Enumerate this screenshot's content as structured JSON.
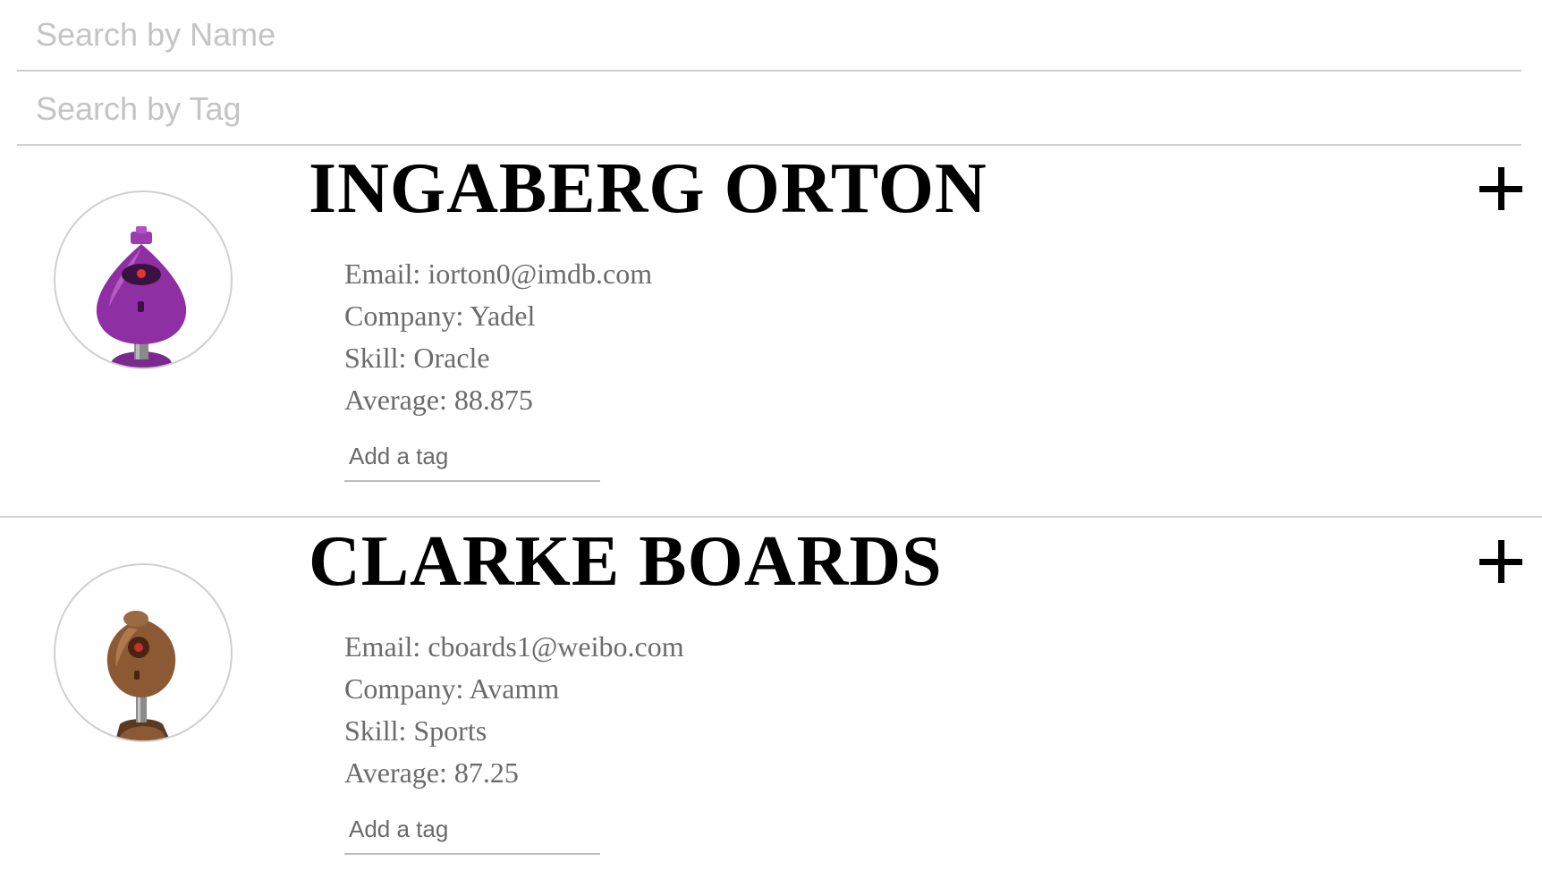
{
  "search": {
    "name_placeholder": "Search by Name",
    "tag_placeholder": "Search by Tag"
  },
  "students": [
    {
      "name": "INGABERG ORTON",
      "email": "Email: iorton0@imdb.com",
      "company": "Company: Yadel",
      "skill": "Skill: Oracle",
      "average": "Average: 88.875",
      "tag_placeholder": "Add a tag",
      "expand_icon": "plus-icon",
      "avatar_color": "#8e2fa3"
    },
    {
      "name": "CLARKE BOARDS",
      "email": "Email: cboards1@weibo.com",
      "company": "Company: Avamm",
      "skill": "Skill: Sports",
      "average": "Average: 87.25",
      "tag_placeholder": "Add a tag",
      "expand_icon": "plus-icon",
      "avatar_color": "#8b5a35"
    }
  ]
}
